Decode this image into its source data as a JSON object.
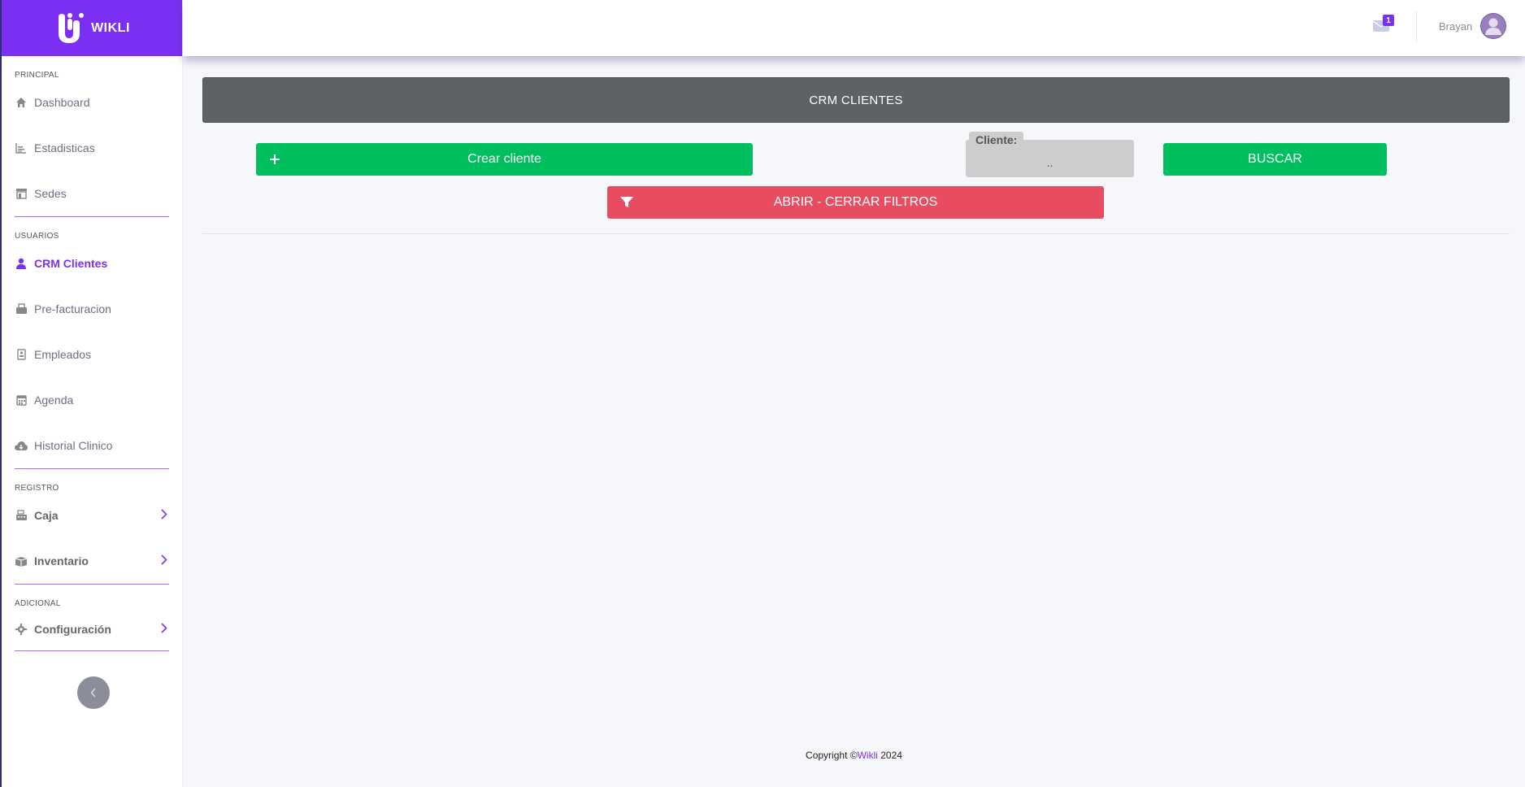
{
  "brand": {
    "name": "WIKLI"
  },
  "topbar": {
    "mail_count": "1",
    "user_name": "Brayan"
  },
  "sidebar": {
    "sections": [
      {
        "title": "PRINCIPAL",
        "items": [
          {
            "label": "Dashboard",
            "icon": "home-icon"
          },
          {
            "label": "Estadisticas",
            "icon": "chart-icon"
          },
          {
            "label": "Sedes",
            "icon": "store-icon"
          }
        ]
      },
      {
        "title": "USUARIOS",
        "items": [
          {
            "label": "CRM Clientes",
            "icon": "user-icon",
            "active": true
          },
          {
            "label": "Pre-facturacion",
            "icon": "invoice-icon"
          },
          {
            "label": "Empleados",
            "icon": "badge-icon"
          },
          {
            "label": "Agenda",
            "icon": "calendar-icon"
          },
          {
            "label": "Historial Clinico",
            "icon": "cloud-download-icon"
          }
        ]
      },
      {
        "title": "REGISTRO",
        "items": [
          {
            "label": "Caja",
            "icon": "cash-register-icon",
            "expandable": true
          },
          {
            "label": "Inventario",
            "icon": "box-icon",
            "expandable": true
          }
        ]
      },
      {
        "title": "ADICIONAL",
        "items": [
          {
            "label": "Configuración",
            "icon": "gear-icon",
            "expandable": true
          }
        ]
      }
    ]
  },
  "main": {
    "title": "CRM CLIENTES",
    "create_label": "Crear cliente",
    "client_label": "Cliente:",
    "client_value": "..",
    "search_label": "BUSCAR",
    "filters_label": "ABRIR - CERRAR FILTROS"
  },
  "footer": {
    "prefix": "Copyright ©",
    "brand": "Wikli",
    "year": " 2024"
  },
  "colors": {
    "accent": "#7b2ff2",
    "green": "#00bf5f",
    "red": "#e84c60",
    "title_bg": "#5e6166"
  }
}
